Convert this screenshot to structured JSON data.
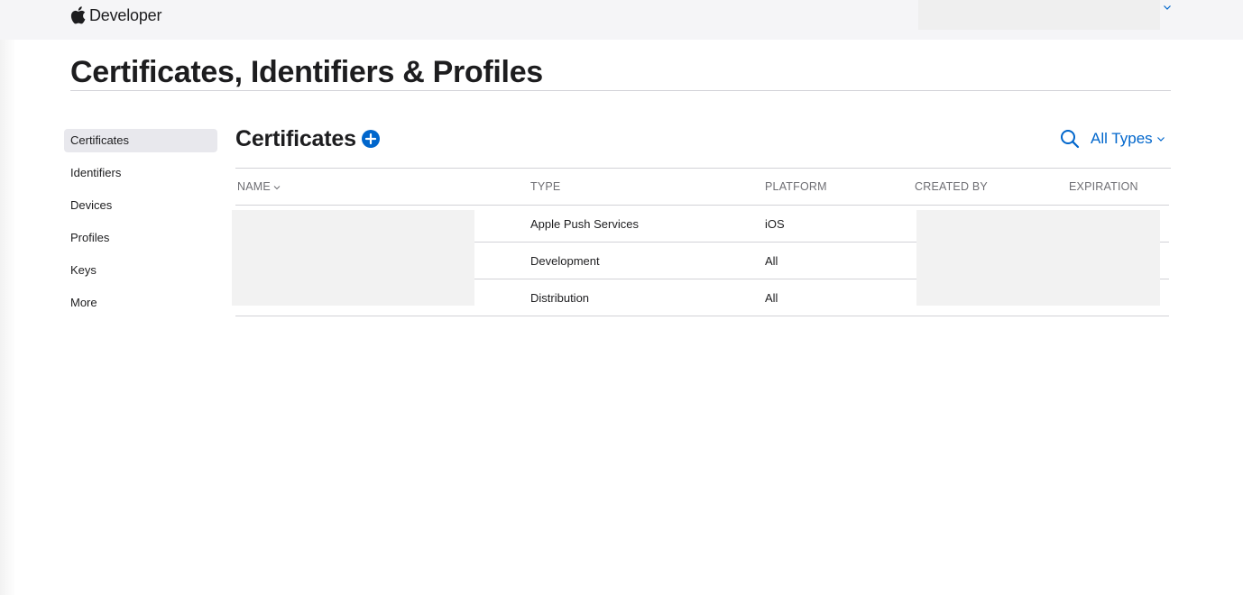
{
  "header": {
    "brand": "Developer",
    "icons": {
      "logo": "apple-logo-icon",
      "account_menu": "chevron-down-icon"
    }
  },
  "page": {
    "title": "Certificates, Identifiers & Profiles"
  },
  "sidebar": {
    "items": [
      {
        "label": "Certificates",
        "active": true
      },
      {
        "label": "Identifiers",
        "active": false
      },
      {
        "label": "Devices",
        "active": false
      },
      {
        "label": "Profiles",
        "active": false
      },
      {
        "label": "Keys",
        "active": false
      },
      {
        "label": "More",
        "active": false
      }
    ]
  },
  "section": {
    "title": "Certificates",
    "filter_label": "All Types",
    "icons": {
      "add": "plus-circle-icon",
      "search": "search-icon",
      "filter": "chevron-down-icon"
    }
  },
  "table": {
    "columns": [
      "NAME",
      "TYPE",
      "PLATFORM",
      "CREATED BY",
      "EXPIRATION"
    ],
    "rows": [
      {
        "type": "Apple Push Services",
        "platform": "iOS"
      },
      {
        "type": "Development",
        "platform": "All"
      },
      {
        "type": "Distribution",
        "platform": "All"
      }
    ]
  },
  "colors": {
    "accent": "#0066cc",
    "text": "#1d1d1f",
    "secondary_text": "#6e6e73",
    "topbar_bg": "#f5f5f7",
    "active_item_bg": "#e8e8ed",
    "divider": "#d2d2d7",
    "redaction": "#f2f2f2"
  }
}
